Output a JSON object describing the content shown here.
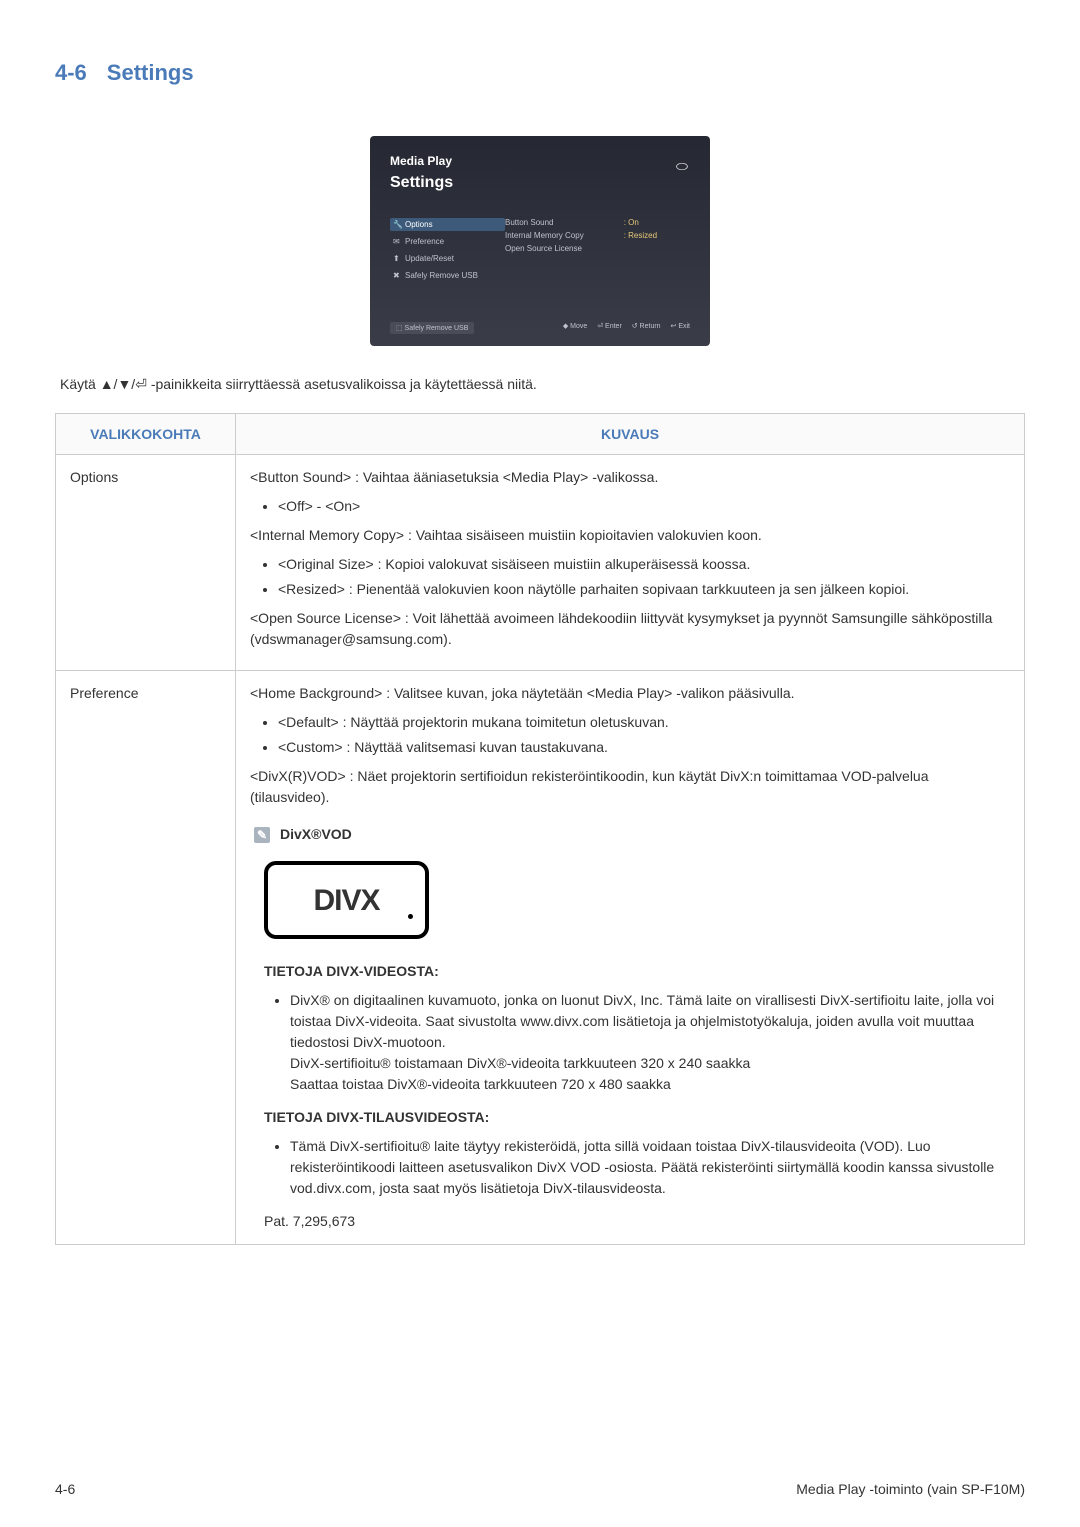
{
  "header": {
    "section_num": "4-6",
    "section_title": "Settings"
  },
  "screenshot": {
    "title1": "Media Play",
    "title2": "Settings",
    "usb_icon": "⬭",
    "left": {
      "sel_ico": "🔧",
      "sel": "Options",
      "i2_ico": "✉",
      "i2": "Preference",
      "i3_ico": "⬆",
      "i3": "Update/Reset",
      "i4_ico": "✖",
      "i4": "Safely Remove USB"
    },
    "right_c1": {
      "r1": "Button Sound",
      "r2": "Internal Memory Copy",
      "r3": "Open Source License"
    },
    "right_c2": {
      "r1": ": On",
      "r2": ": Resized"
    },
    "bottom_left": "⬚ Safely Remove USB",
    "bottom_right": {
      "a": "◆ Move",
      "b": "⏎ Enter",
      "c": "↺ Return",
      "d": "↩ Exit"
    }
  },
  "intro": {
    "pre": "Käytä ",
    "arrows": "▲/▼/⏎",
    "post": " -painikkeita siirryttäessä asetusvalikoissa ja käytettäessä niitä."
  },
  "table": {
    "h1": "VALIKKOKOHTA",
    "h2": "KUVAUS",
    "r1": {
      "name": "Options",
      "p1": "<Button Sound> : Vaihtaa ääniasetuksia <Media Play> -valikossa.",
      "li1": "<Off> - <On>",
      "p2": "<Internal Memory Copy> : Vaihtaa sisäiseen muistiin kopioitavien valokuvien koon.",
      "li2a": "<Original Size> : Kopioi valokuvat sisäiseen muistiin alkuperäisessä koossa.",
      "li2b": "<Resized> : Pienentää valokuvien koon näytölle parhaiten sopivaan tarkkuuteen ja sen jälkeen kopioi.",
      "p3": "<Open Source License> : Voit lähettää avoimeen lähdekoodiin liittyvät kysymykset ja pyynnöt Samsungille sähköpostilla (vdswmanager@samsung.com)."
    },
    "r2": {
      "name": "Preference",
      "p1": "<Home Background> : Valitsee kuvan, joka näytetään <Media Play> -valikon pääsivulla.",
      "li1a": "<Default> : Näyttää projektorin mukana toimitetun oletuskuvan.",
      "li1b": "<Custom> : Näyttää valitsemasi kuvan taustakuvana.",
      "p2": "<DivX(R)VOD> : Näet projektorin sertifioidun rekisteröintikoodin, kun käytät DivX:n toimittamaa VOD-palvelua (tilausvideo).",
      "info_label": "DivX®VOD",
      "divx_logo_text": "DIVX",
      "sub1": "TIETOJA DIVX-VIDEOSTA:",
      "s1li": "DivX® on digitaalinen kuvamuoto, jonka on luonut DivX, Inc. Tämä laite on virallisesti DivX-sertifioitu laite, jolla voi toistaa DivX-videoita. Saat sivustolta www.divx.com lisätietoja ja ohjelmistotyökaluja, joiden avulla voit muuttaa tiedostosi DivX-muotoon.\nDivX-sertifioitu® toistamaan DivX®-videoita tarkkuuteen 320 x 240 saakka\nSaattaa toistaa DivX®-videoita tarkkuuteen 720 x 480 saakka",
      "sub2": "TIETOJA DIVX-TILAUSVIDEOSTA:",
      "s2li": "Tämä DivX-sertifioitu® laite täytyy rekisteröidä, jotta sillä voidaan toistaa DivX-tilausvideoita (VOD). Luo rekisteröintikoodi laitteen asetusvalikon DivX VOD -osiosta. Päätä rekisteröinti siirtymällä koodin kanssa sivustolle vod.divx.com, josta saat myös lisätietoja DivX-tilausvideosta.",
      "pat": "Pat. 7,295,673"
    }
  },
  "footer": {
    "left": "4-6",
    "right": "Media Play -toiminto (vain SP-F10M)"
  }
}
